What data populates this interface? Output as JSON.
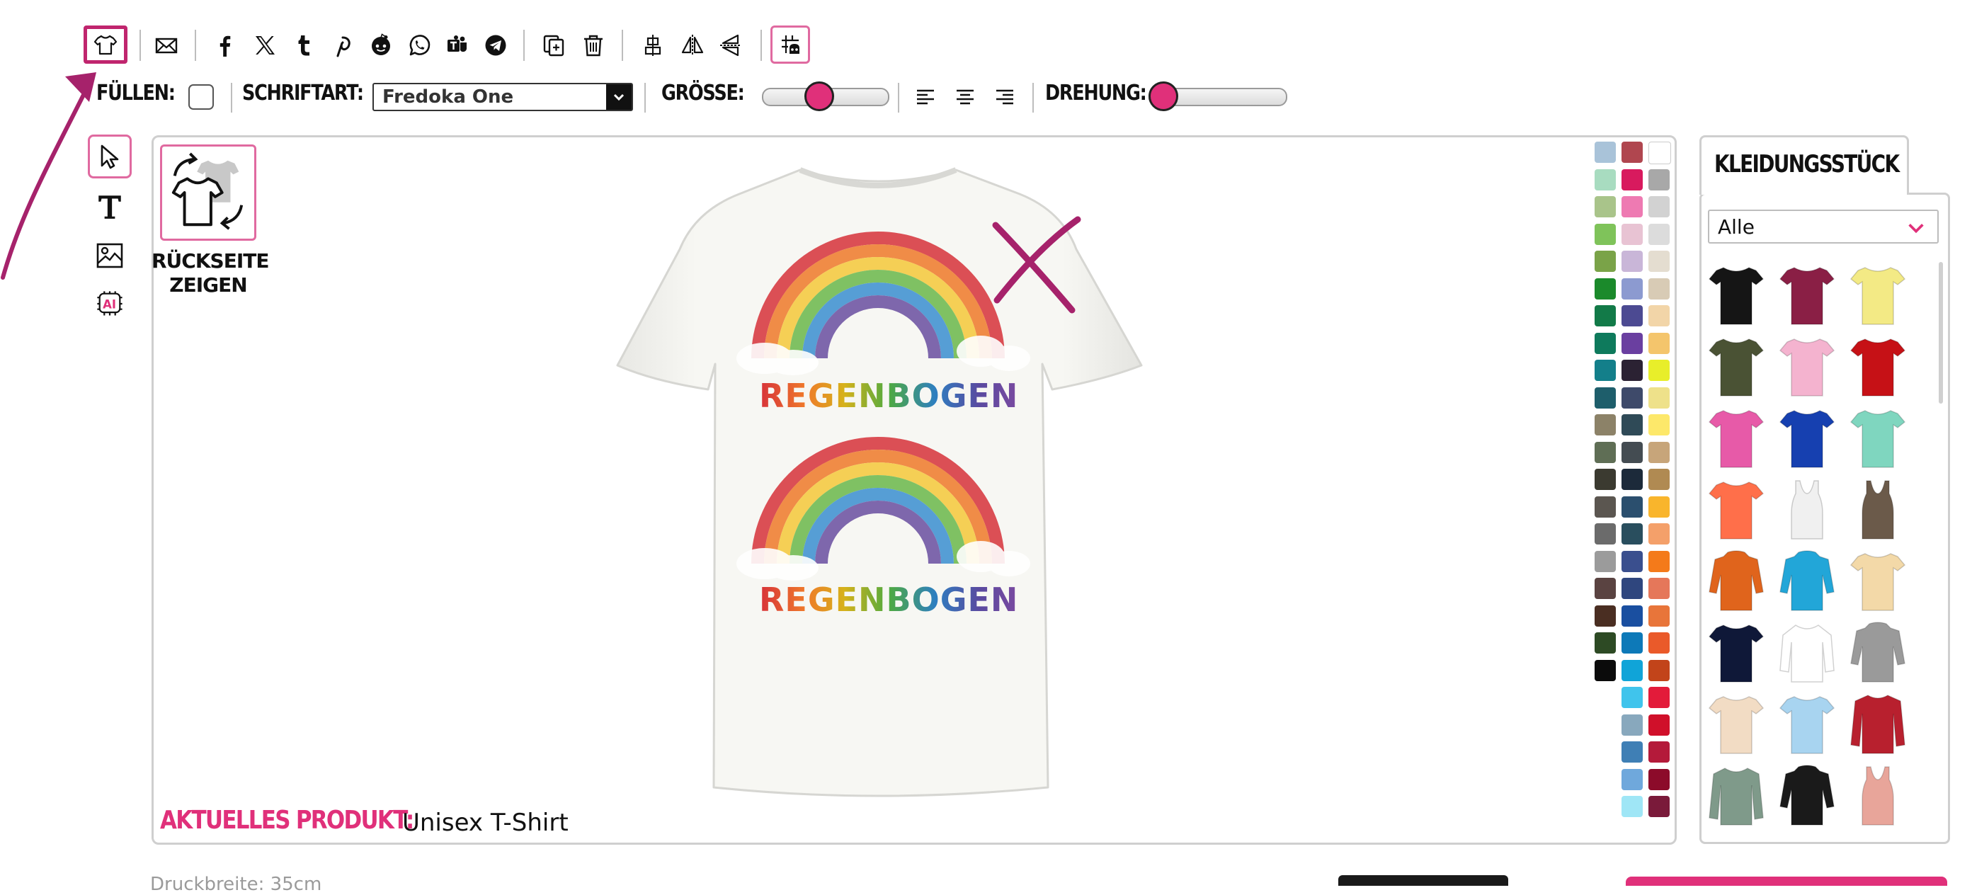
{
  "toolbar": {
    "icons": [
      "tshirt-icon",
      "envelope-icon",
      "facebook-icon",
      "x-icon",
      "tumblr-icon",
      "pinterest-icon",
      "reddit-icon",
      "whatsapp-icon",
      "teams-icon",
      "telegram-icon",
      "duplicate-icon",
      "trash-icon",
      "center-vertical-icon",
      "flip-horizontal-icon",
      "flip-vertical-icon",
      "grid-icon"
    ]
  },
  "format_bar": {
    "fill_label": "FÜLLEN:",
    "font_label": "SCHRIFTART:",
    "font_value": "Fredoka One",
    "size_label": "GRÖSSE:",
    "size_level": 0.45,
    "rotation_label": "DREHUNG:",
    "rotation_level": 0.0
  },
  "left_tools": [
    "pointer-icon",
    "text-icon",
    "image-icon",
    "ai-icon"
  ],
  "back_side": {
    "label_line1": "RÜCKSEITE",
    "label_line2": "ZEIGEN"
  },
  "design": {
    "texts": [
      "REGENBOGEN",
      "REGENBOGEN"
    ]
  },
  "current_product": {
    "label": "AKTUELLES PRODUKT:",
    "value": "Unisex T-Shirt"
  },
  "palette": {
    "col1": [
      "#a9c3d9",
      "#a8dcc0",
      "#a9c48a",
      "#7fc35a",
      "#7aa348",
      "#1b8a2b",
      "#127a48",
      "#0e7a5c",
      "#137f8a",
      "#1e5e6b",
      "#8c8268",
      "#5f6e55",
      "#3b3a30",
      "#5b5650",
      "#6b6b6b",
      "#9b9b9b",
      "#5a4341",
      "#4a2e22",
      "#2d4a24",
      "#0b0b0b"
    ],
    "col2": [
      "#b0464f",
      "#d81a5e",
      "#ee7ab2",
      "#e8c3d3",
      "#c9b6d8",
      "#8c9ad0",
      "#4c4a92",
      "#6a3fa0",
      "#2b2233",
      "#3e4a6a",
      "#2f4a57",
      "#444c52",
      "#1c2a3a",
      "#2b4f6e",
      "#294e5e",
      "#3a4f8e",
      "#2f467e",
      "#1a4fa0",
      "#0d79b8",
      "#10a4d8",
      "#40c4ec",
      "#88a8bd",
      "#3f7fb5",
      "#6fa8dc",
      "#9fe6f6"
    ],
    "col3": [
      "#ffffff",
      "#a8a8a8",
      "#d2d2d2",
      "#dcdcdc",
      "#e4ddd0",
      "#d8cbb5",
      "#f2d5a8",
      "#f4c56c",
      "#e8ee2a",
      "#eee18a",
      "#fde86a",
      "#c7a57a",
      "#b08a52",
      "#f9b52c",
      "#f4a06a",
      "#f47a1a",
      "#e5775a",
      "#e8753a",
      "#ea5a2a",
      "#c2441a",
      "#e31b3a",
      "#d0102a",
      "#b41a3a",
      "#8c0b2a",
      "#7a1a3a"
    ]
  },
  "garments": {
    "tab_label": "KLEIDUNGSSTÜCK",
    "filter_value": "Alle",
    "items": [
      {
        "color": "#151515",
        "kind": "tee"
      },
      {
        "color": "#8a1f45",
        "kind": "tee"
      },
      {
        "color": "#f3ea85",
        "kind": "tee"
      },
      {
        "color": "#4a5234",
        "kind": "tee"
      },
      {
        "color": "#f4b3cf",
        "kind": "tee"
      },
      {
        "color": "#c61116",
        "kind": "tee"
      },
      {
        "color": "#e75aa8",
        "kind": "tee"
      },
      {
        "color": "#1640b0",
        "kind": "tee"
      },
      {
        "color": "#7fd6bf",
        "kind": "tee"
      },
      {
        "color": "#ff6f4a",
        "kind": "tee"
      },
      {
        "color": "#f0f0f0",
        "kind": "tank"
      },
      {
        "color": "#6b5a4a",
        "kind": "tank"
      },
      {
        "color": "#e0641c",
        "kind": "hoodie"
      },
      {
        "color": "#22a6d8",
        "kind": "hoodie"
      },
      {
        "color": "#f3d9a8",
        "kind": "tee"
      },
      {
        "color": "#0f1838",
        "kind": "tee"
      },
      {
        "color": "#ffffff",
        "kind": "raglan"
      },
      {
        "color": "#9a9a9a",
        "kind": "hoodie"
      },
      {
        "color": "#f2dcc4",
        "kind": "tee"
      },
      {
        "color": "#a8d4f0",
        "kind": "tee"
      },
      {
        "color": "#b8202e",
        "kind": "jacket"
      },
      {
        "color": "#7f9a8a",
        "kind": "longsleeve"
      },
      {
        "color": "#1a1a1a",
        "kind": "hoodie"
      },
      {
        "color": "#e8a59a",
        "kind": "tank"
      }
    ]
  },
  "footer": {
    "print_width": "Druckbreite: 35cm"
  }
}
